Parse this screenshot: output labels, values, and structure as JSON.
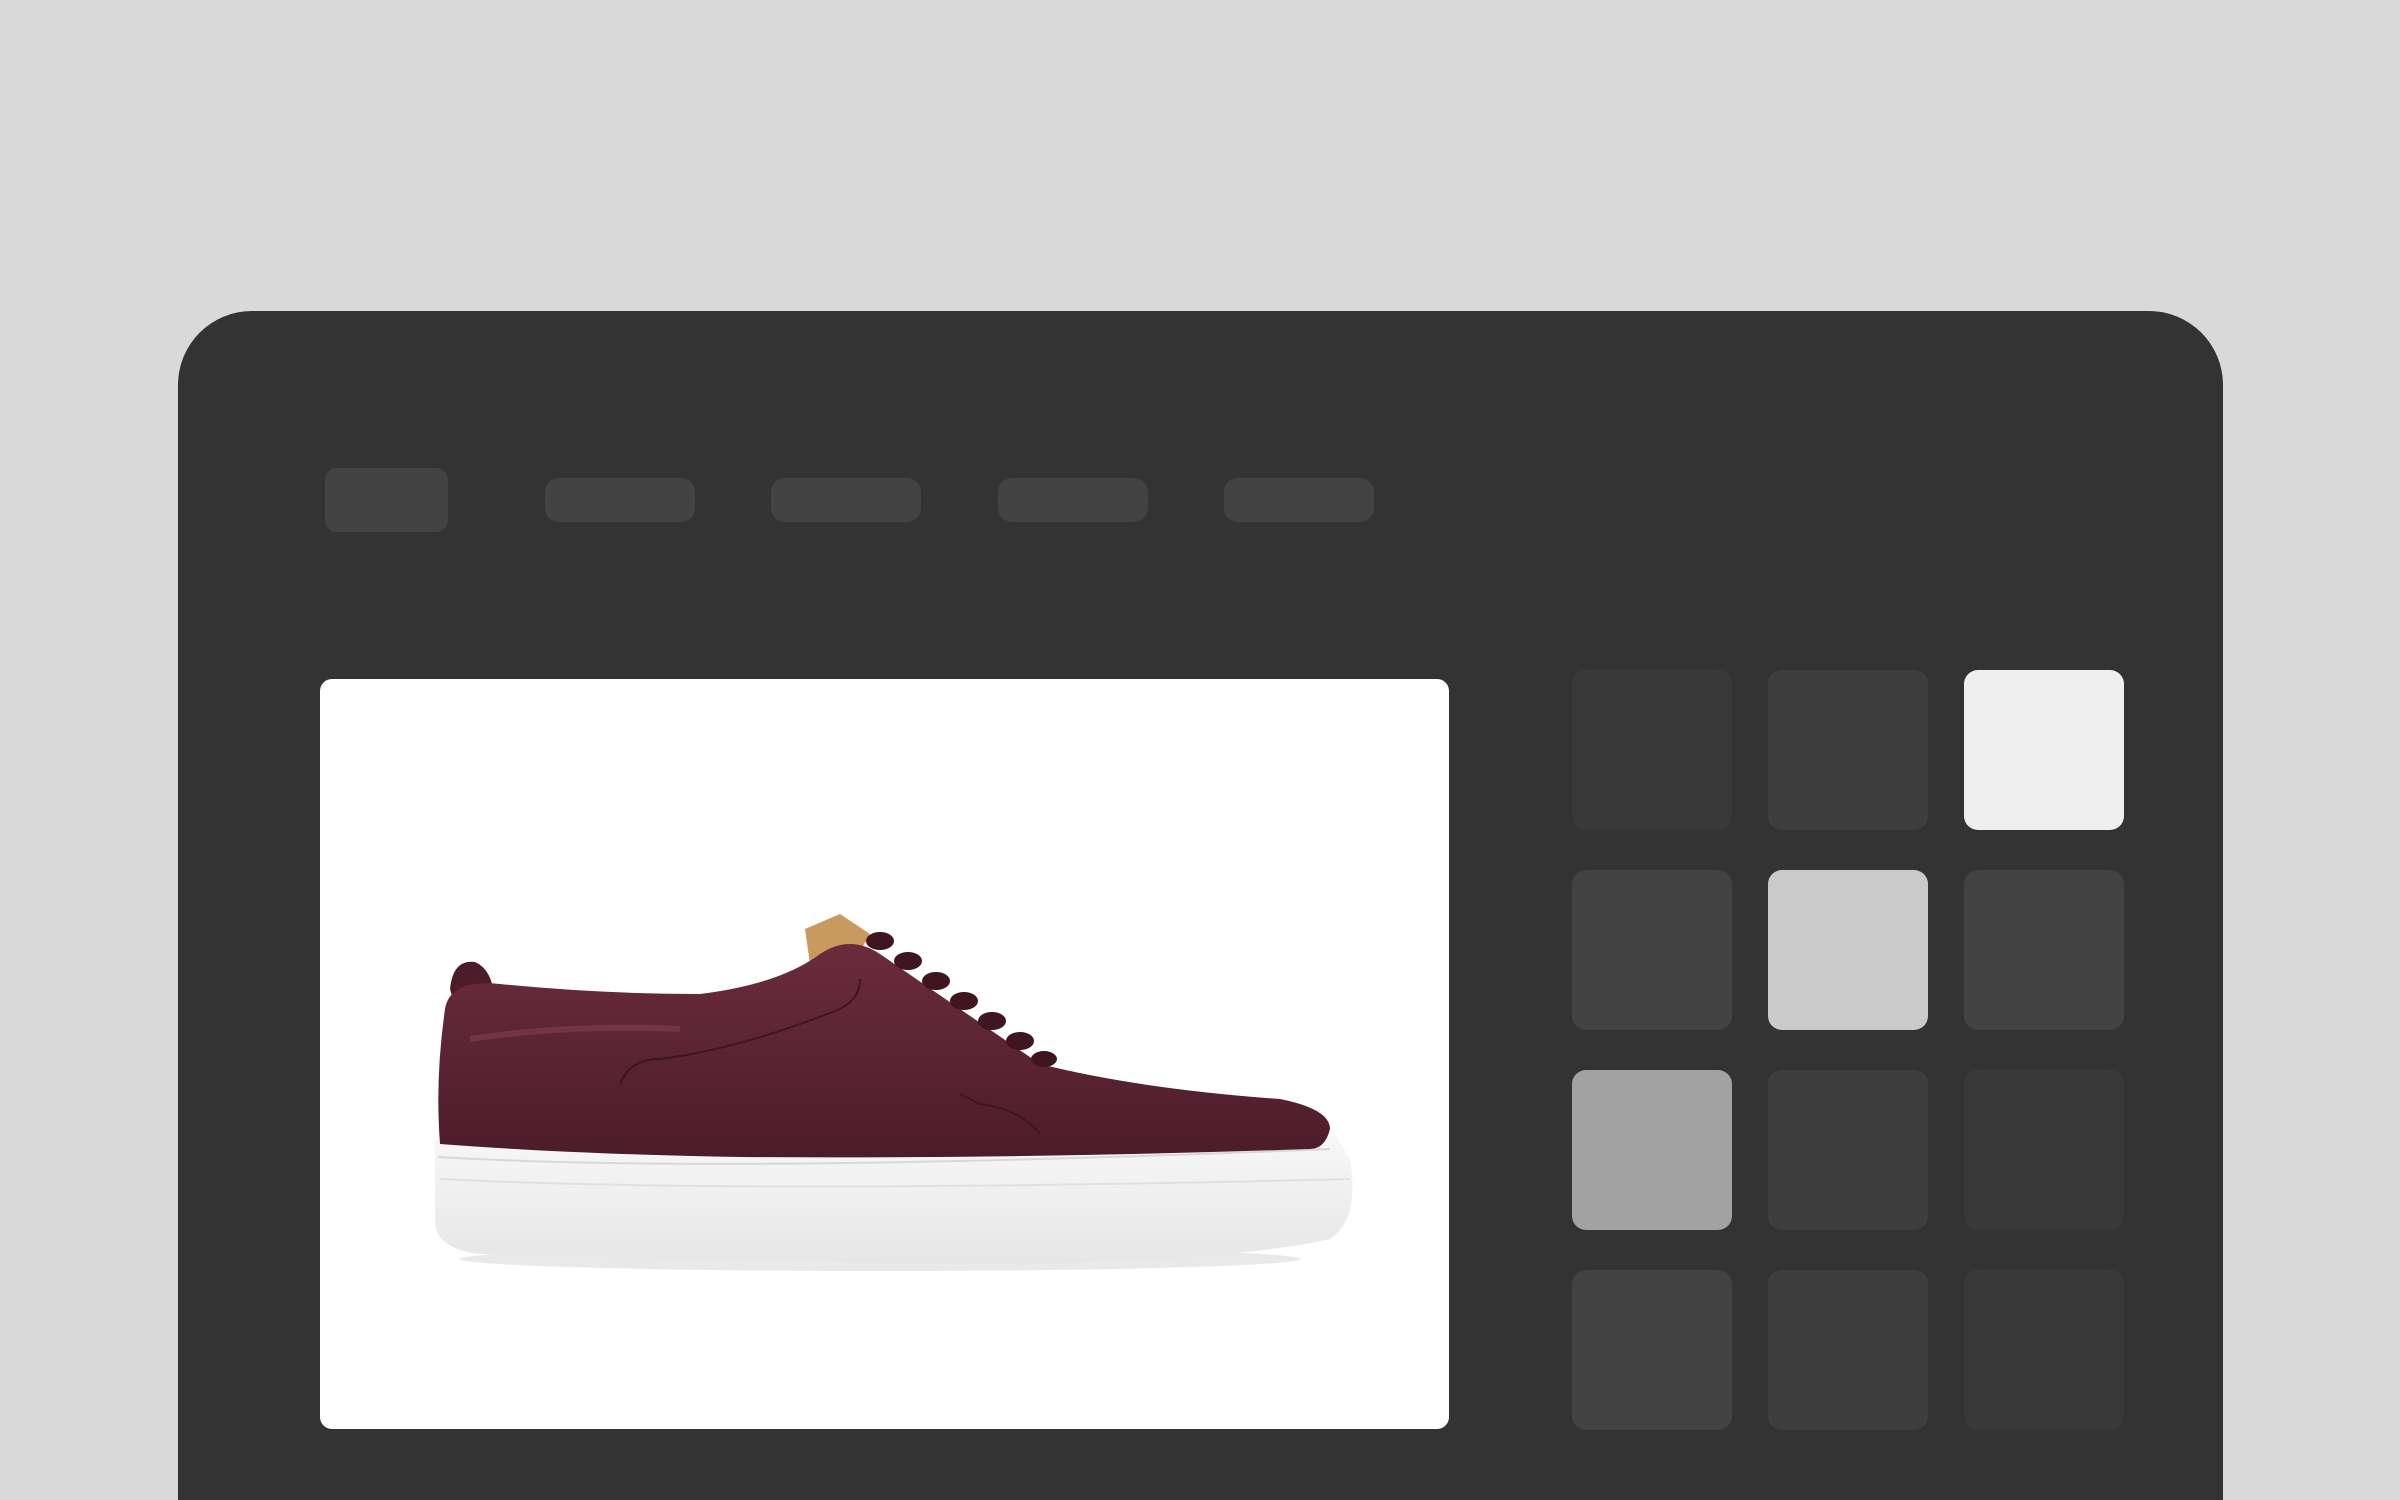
{
  "nav": {
    "items": [
      "",
      "",
      "",
      ""
    ]
  },
  "product_image": {
    "subject": "sneaker-icon",
    "colors": {
      "upper": "#5a2333",
      "sole": "#f2f2f2",
      "tongue": "#c99a5e"
    }
  },
  "swatch_grid": {
    "columns": 3,
    "rows": 4,
    "colors": [
      "#393939",
      "#3e3e3e",
      "#efefef",
      "#434343",
      "#cacaca",
      "#434343",
      "#a2a2a2",
      "#3e3e3e",
      "#393939",
      "#434343",
      "#3e3e3e",
      "#393939"
    ]
  },
  "colors": {
    "page_background": "#d9d9d9",
    "frame_background": "#333333",
    "placeholder": "#434343",
    "photo_background": "#ffffff"
  }
}
